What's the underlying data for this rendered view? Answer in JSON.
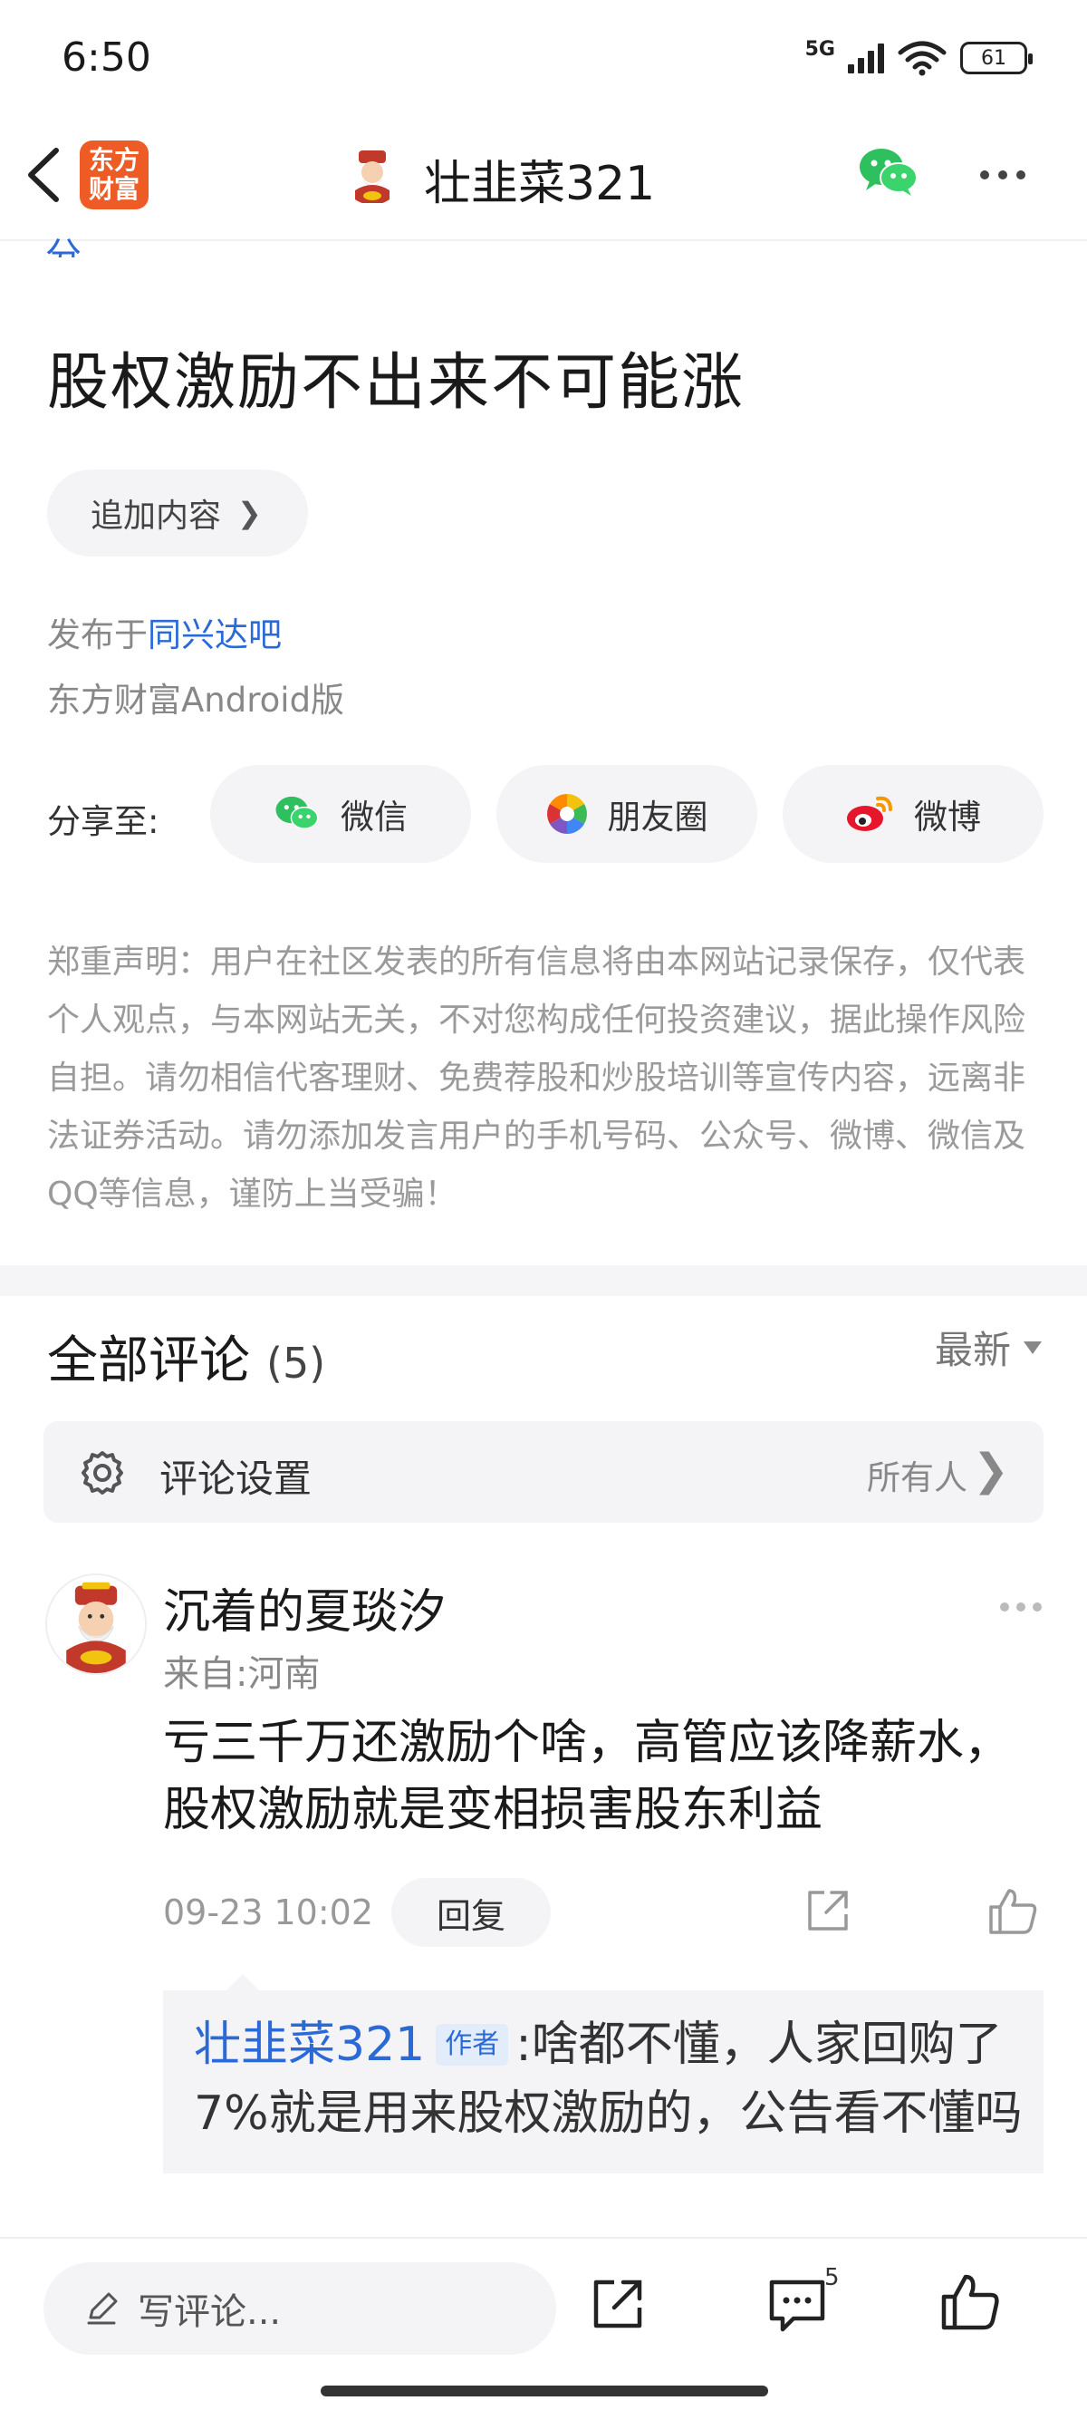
{
  "status_bar": {
    "time": "6:50",
    "network": "5G",
    "battery": "61"
  },
  "nav": {
    "app_logo": "东方财富",
    "title": "壮韭菜321",
    "icons": [
      "back-icon",
      "wechat-icon",
      "more-icon"
    ]
  },
  "post": {
    "cut_text": "分",
    "title": "股权激励不出来不可能涨",
    "append_button": "追加内容",
    "posted_prefix": "发布于",
    "posted_board": "同兴达吧",
    "client": "东方财富Android版"
  },
  "share": {
    "label": "分享至:",
    "options": [
      {
        "label": "微信",
        "icon": "wechat-icon"
      },
      {
        "label": "朋友圈",
        "icon": "moments-icon"
      },
      {
        "label": "微博",
        "icon": "weibo-icon"
      }
    ]
  },
  "disclaimer": "郑重声明：用户在社区发表的所有信息将由本网站记录保存，仅代表个人观点，与本网站无关，不对您构成任何投资建议，据此操作风险自担。请勿相信代客理财、免费荐股和炒股培训等宣传内容，远离非法证券活动。请勿添加发言用户的手机号码、公众号、微博、微信及QQ等信息，谨防上当受骗！",
  "comments": {
    "title": "全部评论",
    "count": "(5)",
    "sort": "最新",
    "settings_label": "评论设置",
    "settings_value": "所有人",
    "items": [
      {
        "user": "沉着的夏琰汐",
        "location": "来自:河南",
        "text": "亏三千万还激励个啥，高管应该降薪水，股权激励就是变相损害股东利益",
        "time": "09-23 10:02",
        "reply_label": "回复",
        "reply": {
          "author": "壮韭菜321",
          "tag": "作者",
          "text": ":啥都不懂，人家回购了7%就是用来股权激励的，公告看不懂吗"
        }
      }
    ]
  },
  "bottom_bar": {
    "write_placeholder": "写评论...",
    "comment_count": "5"
  },
  "colors": {
    "link": "#2b6ad6",
    "brand": "#ef5b25",
    "muted": "#9a9a9a"
  }
}
